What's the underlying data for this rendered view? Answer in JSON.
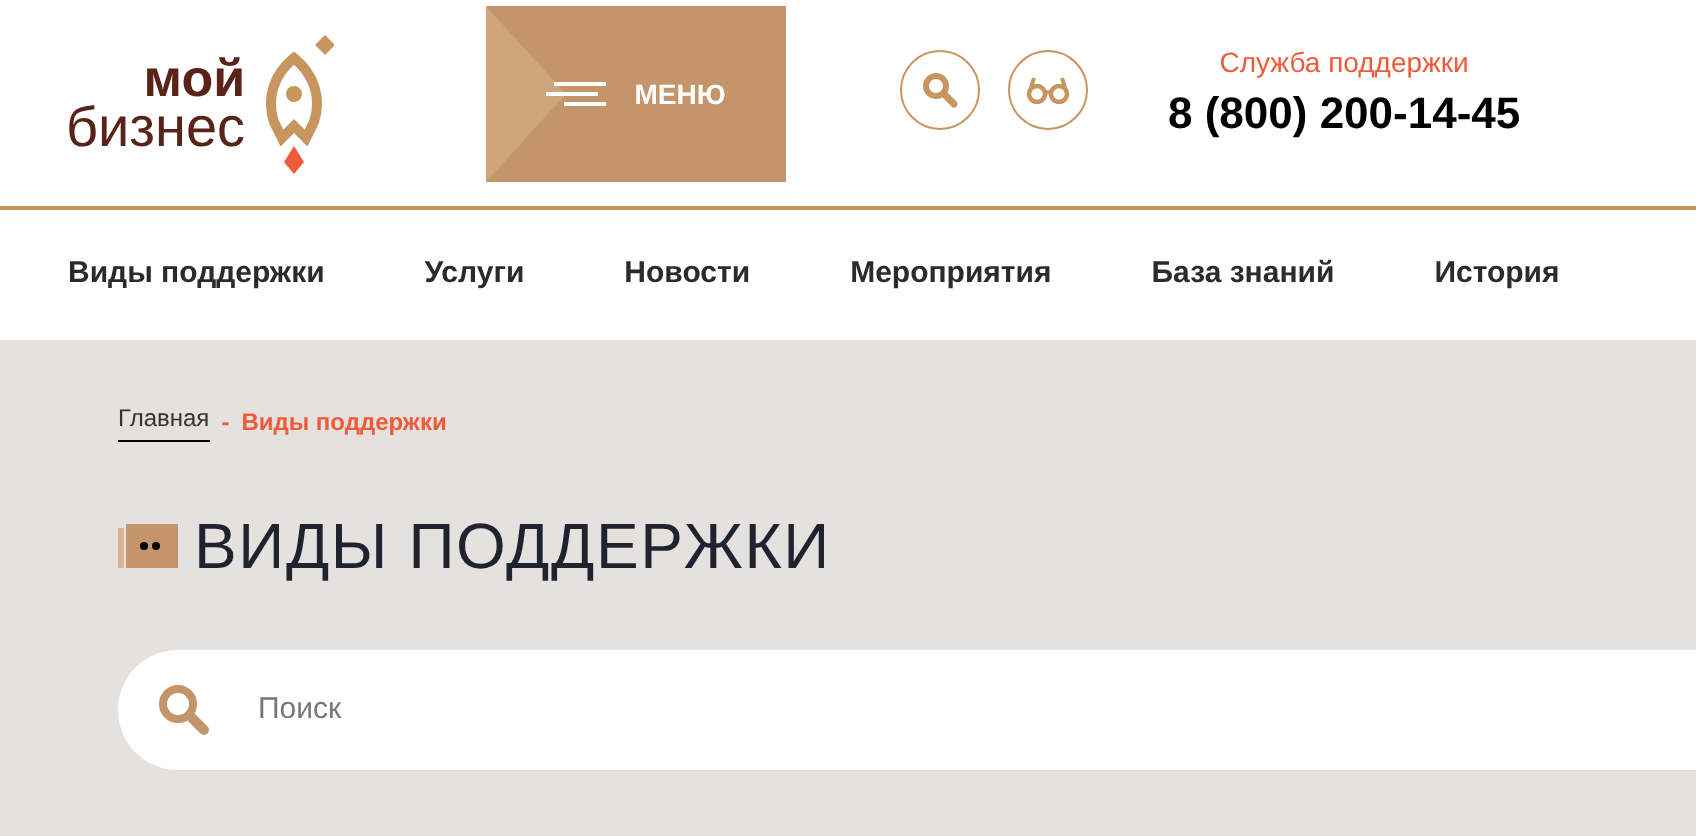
{
  "logo": {
    "line1": "мой",
    "line2": "бизнес"
  },
  "menu_button": {
    "label": "МЕНЮ"
  },
  "support": {
    "label": "Служба поддержки",
    "phone": "8 (800) 200-14-45"
  },
  "nav": [
    {
      "label": "Виды поддержки"
    },
    {
      "label": "Услуги"
    },
    {
      "label": "Новости"
    },
    {
      "label": "Мероприятия"
    },
    {
      "label": "База знаний"
    },
    {
      "label": "История"
    }
  ],
  "breadcrumbs": [
    {
      "label": "Главная",
      "current": false
    },
    {
      "label": "Виды поддержки",
      "current": true
    }
  ],
  "breadcrumb_separator": "-",
  "page_title": "ВИДЫ ПОДДЕРЖКИ",
  "search": {
    "placeholder": "Поиск"
  }
}
